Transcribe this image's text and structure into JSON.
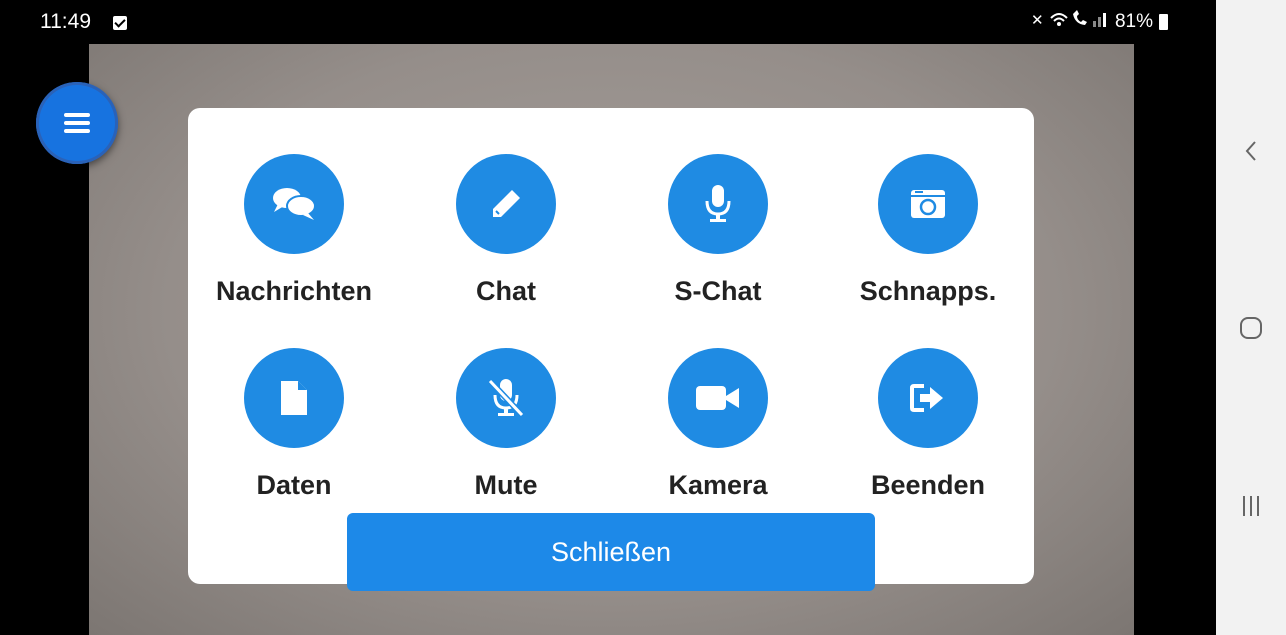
{
  "status_bar": {
    "time": "11:49",
    "icons": "✕ ≈ ☎ .▎▎",
    "battery": "81%"
  },
  "menu_button": {
    "icon": "hamburger-menu-icon"
  },
  "dialog": {
    "items": [
      {
        "label": "Nachrichten",
        "icon": "chat-bubbles-icon"
      },
      {
        "label": "Chat",
        "icon": "pencil-icon"
      },
      {
        "label": "S-Chat",
        "icon": "microphone-icon"
      },
      {
        "label": "Schnapps.",
        "icon": "camera-snapshot-icon"
      },
      {
        "label": "Daten",
        "icon": "file-icon"
      },
      {
        "label": "Mute",
        "icon": "microphone-off-icon"
      },
      {
        "label": "Kamera",
        "icon": "video-camera-icon"
      },
      {
        "label": "Beenden",
        "icon": "sign-out-icon"
      }
    ],
    "close_label": "Schließen"
  },
  "nav_bar": {
    "back": "back-icon",
    "home": "home-icon",
    "recents": "recents-icon"
  },
  "colors": {
    "accent": "#1f8be3",
    "button": "#1d89e8",
    "fab": "#1773e0"
  }
}
